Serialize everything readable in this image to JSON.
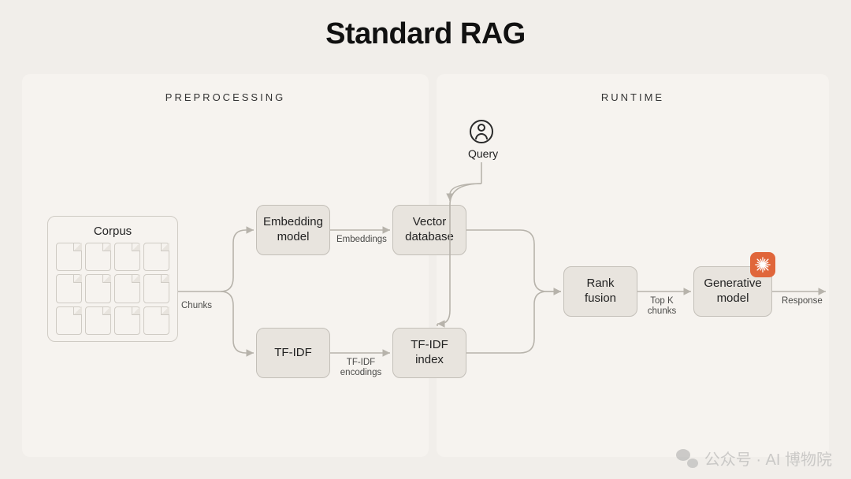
{
  "title": "Standard RAG",
  "sections": {
    "preprocessing": "PREPROCESSING",
    "runtime": "RUNTIME"
  },
  "nodes": {
    "corpus": "Corpus",
    "embedding": "Embedding model",
    "tfidf": "TF-IDF",
    "vector_db": "Vector database",
    "tfidf_idx": "TF-IDF index",
    "rank_fusion": "Rank fusion",
    "generative": "Generative model",
    "query": "Query"
  },
  "edges": {
    "chunks": "Chunks",
    "embeddings": "Embeddings",
    "tfidf_encodings": "TF-IDF encodings",
    "top_k": "Top K chunks",
    "response": "Response"
  },
  "icons": {
    "user": "user-icon",
    "brand": "starburst-icon",
    "wechat": "wechat-icon"
  },
  "watermark": "公众号 · AI 博物院"
}
